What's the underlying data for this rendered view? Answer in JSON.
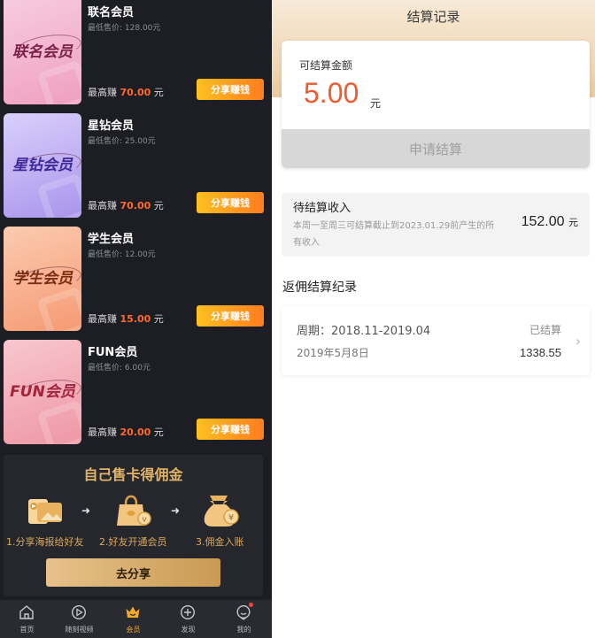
{
  "left": {
    "cards": [
      {
        "name": "联名会员",
        "min_prefix": "最低售价:",
        "min_price": "128.00元",
        "max_prefix": "最高赚",
        "max_value": "70.00",
        "max_unit": "元",
        "button": "分享赚钱",
        "art_text": "联名会员"
      },
      {
        "name": "星钻会员",
        "min_prefix": "最低售价:",
        "min_price": "25.00元",
        "max_prefix": "最高赚",
        "max_value": "70.00",
        "max_unit": "元",
        "button": "分享赚钱",
        "art_text": "星钻会员"
      },
      {
        "name": "学生会员",
        "min_prefix": "最低售价:",
        "min_price": "12.00元",
        "max_prefix": "最高赚",
        "max_value": "15.00",
        "max_unit": "元",
        "button": "分享赚钱",
        "art_text": "学生会员"
      },
      {
        "name": "FUN会员",
        "min_prefix": "最低售价:",
        "min_price": "6.00元",
        "max_prefix": "最高赚",
        "max_value": "20.00",
        "max_unit": "元",
        "button": "分享赚钱",
        "art_text": "FUN会员"
      }
    ],
    "promo": {
      "title": "自己售卡得佣金",
      "steps": [
        {
          "label": "1.分享海报给好友",
          "icon": "poster-icon"
        },
        {
          "label": "2.好友开通会员",
          "icon": "gift-bag-icon"
        },
        {
          "label": "3.佣金入账",
          "icon": "money-bag-icon"
        }
      ],
      "arrow": "➜",
      "share_button": "去分享"
    },
    "tabbar": [
      {
        "label": "首页",
        "icon": "home-icon"
      },
      {
        "label": "随刻视频",
        "icon": "play-icon"
      },
      {
        "label": "会员",
        "icon": "crown-icon",
        "active": true
      },
      {
        "label": "发现",
        "icon": "plus-circle-icon"
      },
      {
        "label": "我的",
        "icon": "user-icon",
        "badge": true
      }
    ]
  },
  "right": {
    "title": "结算记录",
    "amount_label": "可结算金额",
    "amount_value": "5.00",
    "amount_unit": "元",
    "apply_button": "申请结算",
    "pending": {
      "title": "待结算收入",
      "desc": "本周一至周三可结算截止到2023.01.29前产生的所有收入",
      "value": "152.00",
      "unit": "元"
    },
    "records_title": "返佣结算纪录",
    "records": [
      {
        "period": "周期：2018.11-2019.04",
        "status": "已结算",
        "date": "2019年5月8日",
        "amount": "1338.55"
      }
    ]
  },
  "colors": {
    "accent_orange": "#ff7d1f",
    "amount_red": "#f05a2e",
    "gold": "#e3b467"
  }
}
